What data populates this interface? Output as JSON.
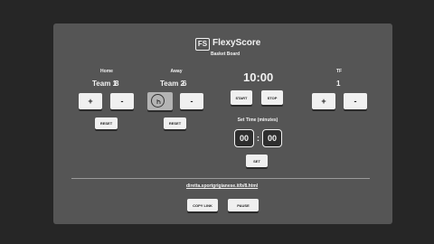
{
  "app": {
    "logo_text": "FS",
    "name": "FlexyScore",
    "sport": "Basket Board"
  },
  "home": {
    "label": "Home",
    "team": "Team 1",
    "score": "8",
    "plus": "+",
    "minus": "-",
    "reset": "RESET"
  },
  "away": {
    "label": "Away",
    "team": "Team 2",
    "score": "6",
    "minus": "-",
    "reset": "RESET"
  },
  "timer": {
    "clock": "10:00",
    "start": "START",
    "stop": "STOP",
    "set_label": "Set Time (minutes)",
    "minutes": "00",
    "separator": ":",
    "seconds": "00",
    "set": "SET"
  },
  "period": {
    "label": "TF",
    "value": "1",
    "plus": "+",
    "minus": "-"
  },
  "footer": {
    "link": "diretta.sportgrigianese.it/b/8.html",
    "copy": "COPY LINK",
    "pause": "PAUSE"
  }
}
